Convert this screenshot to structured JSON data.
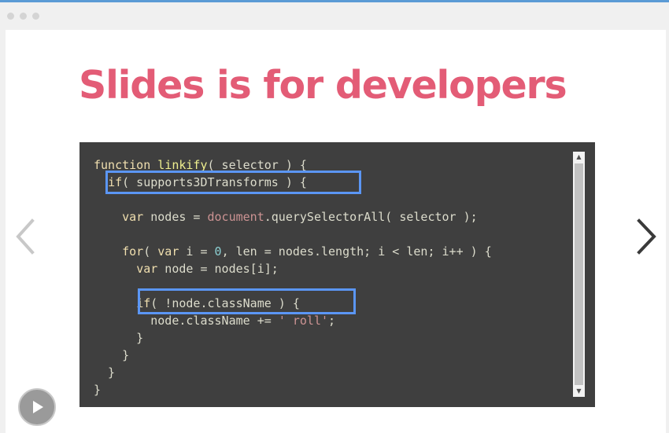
{
  "window": {
    "controls": [
      "dot",
      "dot",
      "dot"
    ]
  },
  "slide": {
    "title": "Slides is for developers"
  },
  "code": {
    "lines": [
      [
        {
          "t": "function ",
          "c": "kw"
        },
        {
          "t": "linkify",
          "c": "fn"
        },
        {
          "t": "( selector ) {",
          "c": ""
        }
      ],
      [
        {
          "t": "  ",
          "c": ""
        },
        {
          "t": "if",
          "c": "kw"
        },
        {
          "t": "( supports3DTransforms ) {",
          "c": ""
        }
      ],
      [],
      [
        {
          "t": "    ",
          "c": ""
        },
        {
          "t": "var",
          "c": "kw"
        },
        {
          "t": " nodes = ",
          "c": ""
        },
        {
          "t": "document",
          "c": "bi"
        },
        {
          "t": ".querySelectorAll( selector );",
          "c": ""
        }
      ],
      [],
      [
        {
          "t": "    ",
          "c": ""
        },
        {
          "t": "for",
          "c": "kw"
        },
        {
          "t": "( ",
          "c": ""
        },
        {
          "t": "var",
          "c": "kw"
        },
        {
          "t": " i = ",
          "c": ""
        },
        {
          "t": "0",
          "c": "num"
        },
        {
          "t": ", len = nodes.length; i < len; i++ ) {",
          "c": ""
        }
      ],
      [
        {
          "t": "      ",
          "c": ""
        },
        {
          "t": "var",
          "c": "kw"
        },
        {
          "t": " node = nodes[i];",
          "c": ""
        }
      ],
      [],
      [
        {
          "t": "      ",
          "c": ""
        },
        {
          "t": "if",
          "c": "kw"
        },
        {
          "t": "( !node.className ) {",
          "c": ""
        }
      ],
      [
        {
          "t": "        node.className += ",
          "c": ""
        },
        {
          "t": "' roll'",
          "c": "str"
        },
        {
          "t": ";",
          "c": ""
        }
      ],
      [
        {
          "t": "      }",
          "c": ""
        }
      ],
      [
        {
          "t": "    }",
          "c": ""
        }
      ],
      [
        {
          "t": "  }",
          "c": ""
        }
      ],
      [
        {
          "t": "}",
          "c": ""
        }
      ]
    ]
  },
  "highlights": [
    {
      "label": "if( supports3DTransforms ) {"
    },
    {
      "label": "if( !node.className ) {"
    }
  ],
  "navigation": {
    "prev_icon": "chevron-left-icon",
    "next_icon": "chevron-right-icon",
    "play_icon": "play-icon"
  },
  "colors": {
    "title": "#e35c76",
    "editor_bg": "#3f3f3f",
    "highlight_border": "#5b96f5",
    "keyword": "#f0dfaf",
    "function_name": "#efef8f",
    "string": "#cc9393",
    "number": "#8cd0d3"
  }
}
